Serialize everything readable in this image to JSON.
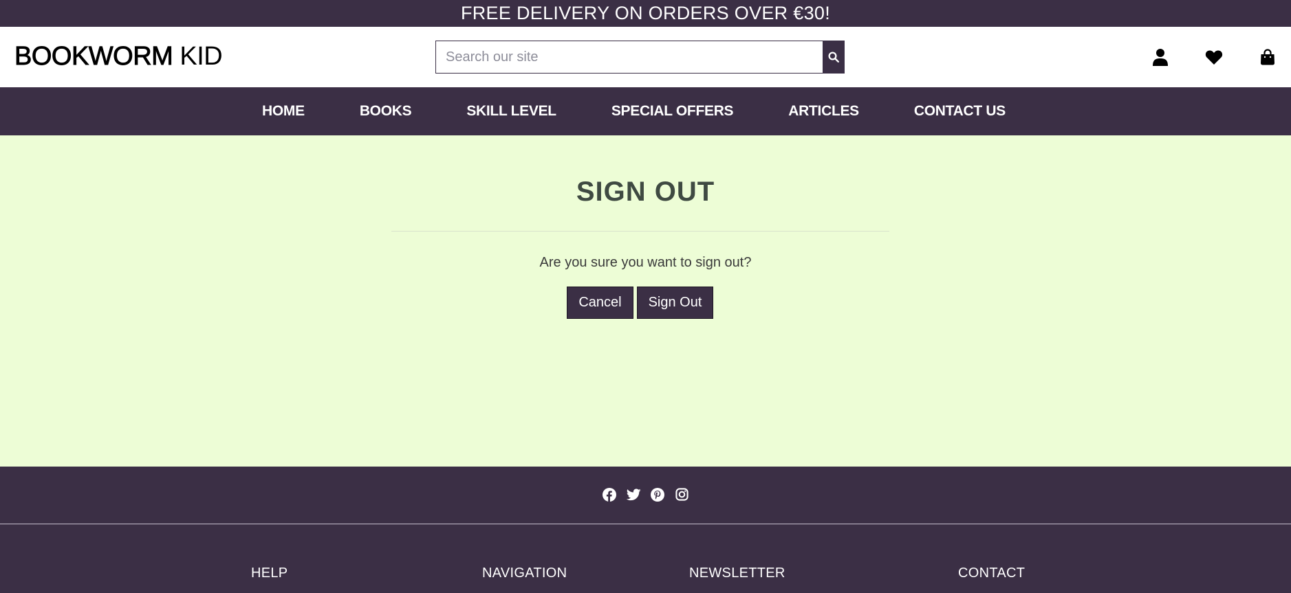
{
  "promo": {
    "text": "FREE DELIVERY ON ORDERS OVER €30!"
  },
  "header": {
    "logo_strong": "BOOKWORM",
    "logo_light": " KID",
    "search": {
      "placeholder": "Search our site"
    },
    "icons": [
      "user-icon",
      "heart-icon",
      "shopping-bag-icon"
    ]
  },
  "nav": {
    "items": [
      {
        "label": "HOME"
      },
      {
        "label": "BOOKS"
      },
      {
        "label": "SKILL LEVEL"
      },
      {
        "label": "SPECIAL OFFERS"
      },
      {
        "label": "ARTICLES"
      },
      {
        "label": "CONTACT US"
      }
    ]
  },
  "main": {
    "title": "SIGN OUT",
    "prompt": "Are you sure you want to sign out?",
    "cancel_label": "Cancel",
    "signout_label": "Sign Out"
  },
  "footer": {
    "social": [
      "facebook-icon",
      "twitter-icon",
      "pinterest-icon",
      "instagram-icon"
    ],
    "columns": [
      {
        "heading": "HELP"
      },
      {
        "heading": "NAVIGATION"
      },
      {
        "heading": "NEWSLETTER"
      },
      {
        "heading": "CONTACT"
      }
    ]
  },
  "colors": {
    "brand": "#3b2f45",
    "page_bg": "#edfdd6",
    "header_bg": "#ffffff"
  }
}
